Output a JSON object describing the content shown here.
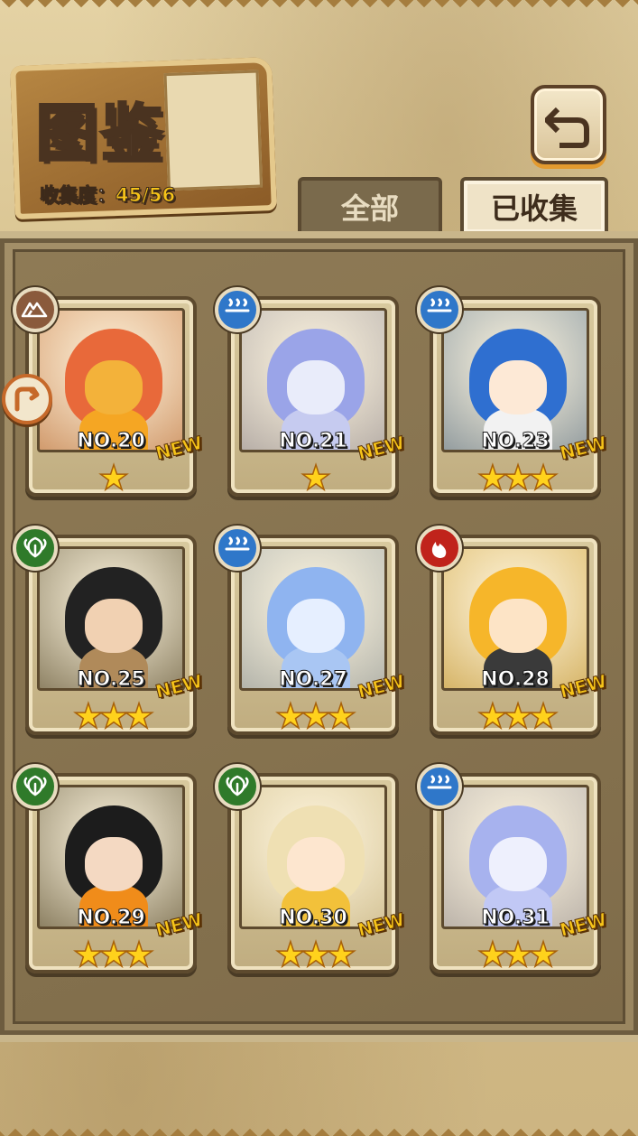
{
  "header": {
    "title": "图鉴",
    "collection_label": "收集度：",
    "collection_value": "45/56"
  },
  "tabs": {
    "all_label": "全部",
    "collected_label": "已收集",
    "active": "collected"
  },
  "colors": {
    "water": "#2f77c9",
    "wind": "#2f7a2a",
    "fire": "#c0231b",
    "earth": "#8a5a3c",
    "star": "#ffd21c",
    "new_badge": "#f6c419"
  },
  "cards": [
    {
      "number": "NO.20",
      "stars": 1,
      "element": "earth-icon",
      "new": "NEW",
      "hair": "#e8693a",
      "face": "#f3b23a",
      "body": "#f5a623"
    },
    {
      "number": "NO.21",
      "stars": 1,
      "element": "water-icon",
      "new": "NEW",
      "hair": "#9aa4e8",
      "face": "#e9ecfa",
      "body": "#c6cbf0"
    },
    {
      "number": "NO.23",
      "stars": 3,
      "element": "water-icon",
      "new": "NEW",
      "hair": "#2f6fd0",
      "face": "#fde9d6",
      "body": "#f2f2f2"
    },
    {
      "number": "NO.25",
      "stars": 3,
      "element": "wind-icon",
      "new": "NEW",
      "hair": "#222222",
      "face": "#f1d1b2",
      "body": "#b08a5a"
    },
    {
      "number": "NO.27",
      "stars": 3,
      "element": "water-icon",
      "new": "NEW",
      "hair": "#8fb4f0",
      "face": "#e6efff",
      "body": "#a9c6f3"
    },
    {
      "number": "NO.28",
      "stars": 3,
      "element": "fire-icon",
      "new": "NEW",
      "hair": "#f6b62a",
      "face": "#fde4c6",
      "body": "#3a3a3a"
    },
    {
      "number": "NO.29",
      "stars": 3,
      "element": "wind-icon",
      "new": "NEW",
      "hair": "#1c1c1c",
      "face": "#f4d9c2",
      "body": "#f08c1a"
    },
    {
      "number": "NO.30",
      "stars": 3,
      "element": "wind-icon",
      "new": "NEW",
      "hair": "#efe0b3",
      "face": "#fde6cf",
      "body": "#f2c13a"
    },
    {
      "number": "NO.31",
      "stars": 3,
      "element": "water-icon",
      "new": "NEW",
      "hair": "#a7b2ee",
      "face": "#eef0fd",
      "body": "#c1c8f5"
    }
  ]
}
